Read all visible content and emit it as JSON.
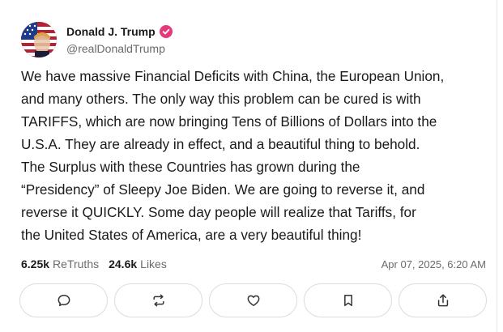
{
  "author": {
    "name": "Donald J. Trump",
    "handle": "@realDonaldTrump",
    "verified_color": "#e5397c"
  },
  "post": {
    "text": "We have massive Financial Deficits with China, the European Union,\nand many others. The only way this problem can be cured is with\nTARIFFS, which are now bringing Tens of Billions of Dollars into the\nU.S.A. They are already in effect, and a beautiful thing to behold.\nThe Surplus with these Countries has grown during the\n“Presidency” of Sleepy Joe Biden. We are going to reverse it, and\nreverse it QUICKLY. Some day people will realize that Tariffs, for\nthe United States of America, are a very beautiful thing!"
  },
  "stats": {
    "retruths_count": "6.25k",
    "retruths_label": "ReTruths",
    "likes_count": "24.6k",
    "likes_label": "Likes",
    "timestamp": "Apr 07, 2025, 6:20 AM"
  },
  "actions": [
    {
      "icon": "comment-icon"
    },
    {
      "icon": "retruth-icon"
    },
    {
      "icon": "like-icon"
    },
    {
      "icon": "bookmark-icon"
    },
    {
      "icon": "share-icon"
    }
  ],
  "colors": {
    "text": "#1a1a1a",
    "muted": "#6b6b6b",
    "border": "#dcdcdc"
  }
}
